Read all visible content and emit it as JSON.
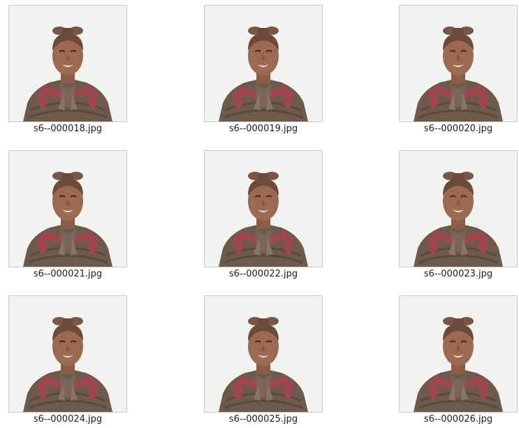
{
  "file_view": {
    "items": [
      {
        "filename": "s6--000018.jpg",
        "thumbnail_icon": "warrior-statue-photo"
      },
      {
        "filename": "s6--000019.jpg",
        "thumbnail_icon": "warrior-statue-photo"
      },
      {
        "filename": "s6--000020.jpg",
        "thumbnail_icon": "warrior-statue-photo"
      },
      {
        "filename": "s6--000021.jpg",
        "thumbnail_icon": "warrior-statue-photo"
      },
      {
        "filename": "s6--000022.jpg",
        "thumbnail_icon": "warrior-statue-photo"
      },
      {
        "filename": "s6--000023.jpg",
        "thumbnail_icon": "warrior-statue-photo"
      },
      {
        "filename": "s6--000024.jpg",
        "thumbnail_icon": "warrior-statue-photo"
      },
      {
        "filename": "s6--000025.jpg",
        "thumbnail_icon": "warrior-statue-photo"
      },
      {
        "filename": "s6--000026.jpg",
        "thumbnail_icon": "warrior-statue-photo"
      }
    ]
  },
  "colors": {
    "background": "#ffffff",
    "thumb_background": "#f2f2f0",
    "thumb_border": "#c9c9c9",
    "caption_text": "#1e1e1e"
  }
}
